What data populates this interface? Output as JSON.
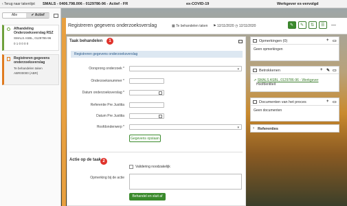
{
  "header": {
    "company": "SMALS - 0406.798.006 - 0129786-96 - Actief - FR",
    "category": "ex-COVID-19",
    "status": "Werkgever ex-vervolgd"
  },
  "sidebar": {
    "back_label": "Terug naar takenlijst",
    "filter": [
      "Alle",
      "Actief"
    ],
    "tasks": [
      {
        "title": "Afhandeling Onderzoeksverslag RSZ",
        "subtitle": "SMALS ASBL, 0129786-96",
        "counts": "0 1 0 0 0 0"
      },
      {
        "title": "Registreren gegevens onderzoeksverslag",
        "note1": "Te behandelen taken",
        "note2": "ABR00000 (ABR)"
      }
    ]
  },
  "main": {
    "title": "Registreren gegevens onderzoeksverslag",
    "meta": [
      "Te behandelen taken",
      "12/11/2020",
      "12/11/2020"
    ],
    "task_section": {
      "title": "Taak behandelen",
      "badge": "1",
      "info": "Registreren gegevens onderzoeksverslag",
      "fields": [
        {
          "label": "Oorsprong onderzoek *"
        },
        {
          "label": "Onderzoeksnummer *"
        },
        {
          "label": "Datum onderzoeksverslag *"
        },
        {
          "label": "Referentie Pre Justitia"
        },
        {
          "label": "Datum Pre Justitia"
        },
        {
          "label": "Hoofdonderwerp *"
        }
      ],
      "save_label": "Gegevens opslaan"
    },
    "action_section": {
      "title": "Actie op de taak",
      "badge": "2",
      "checkbox_label": "Validering noodzakelijk",
      "note_label": "Opmerking bij de actie",
      "finish_label": "Behandel en sluit af"
    }
  },
  "right": {
    "remarks": {
      "title": "Opmerkingen (0)",
      "empty": "Geen opmerkingen"
    },
    "involved": {
      "title": "Betrokkenen",
      "entity": "SMALS ASBL, 0129786-96 - Werkgever",
      "role": "Hoofdentiteit"
    },
    "documents": {
      "title": "Documenten van het proces",
      "empty": "Geen documenten"
    },
    "references": {
      "title": "Referenties"
    }
  }
}
